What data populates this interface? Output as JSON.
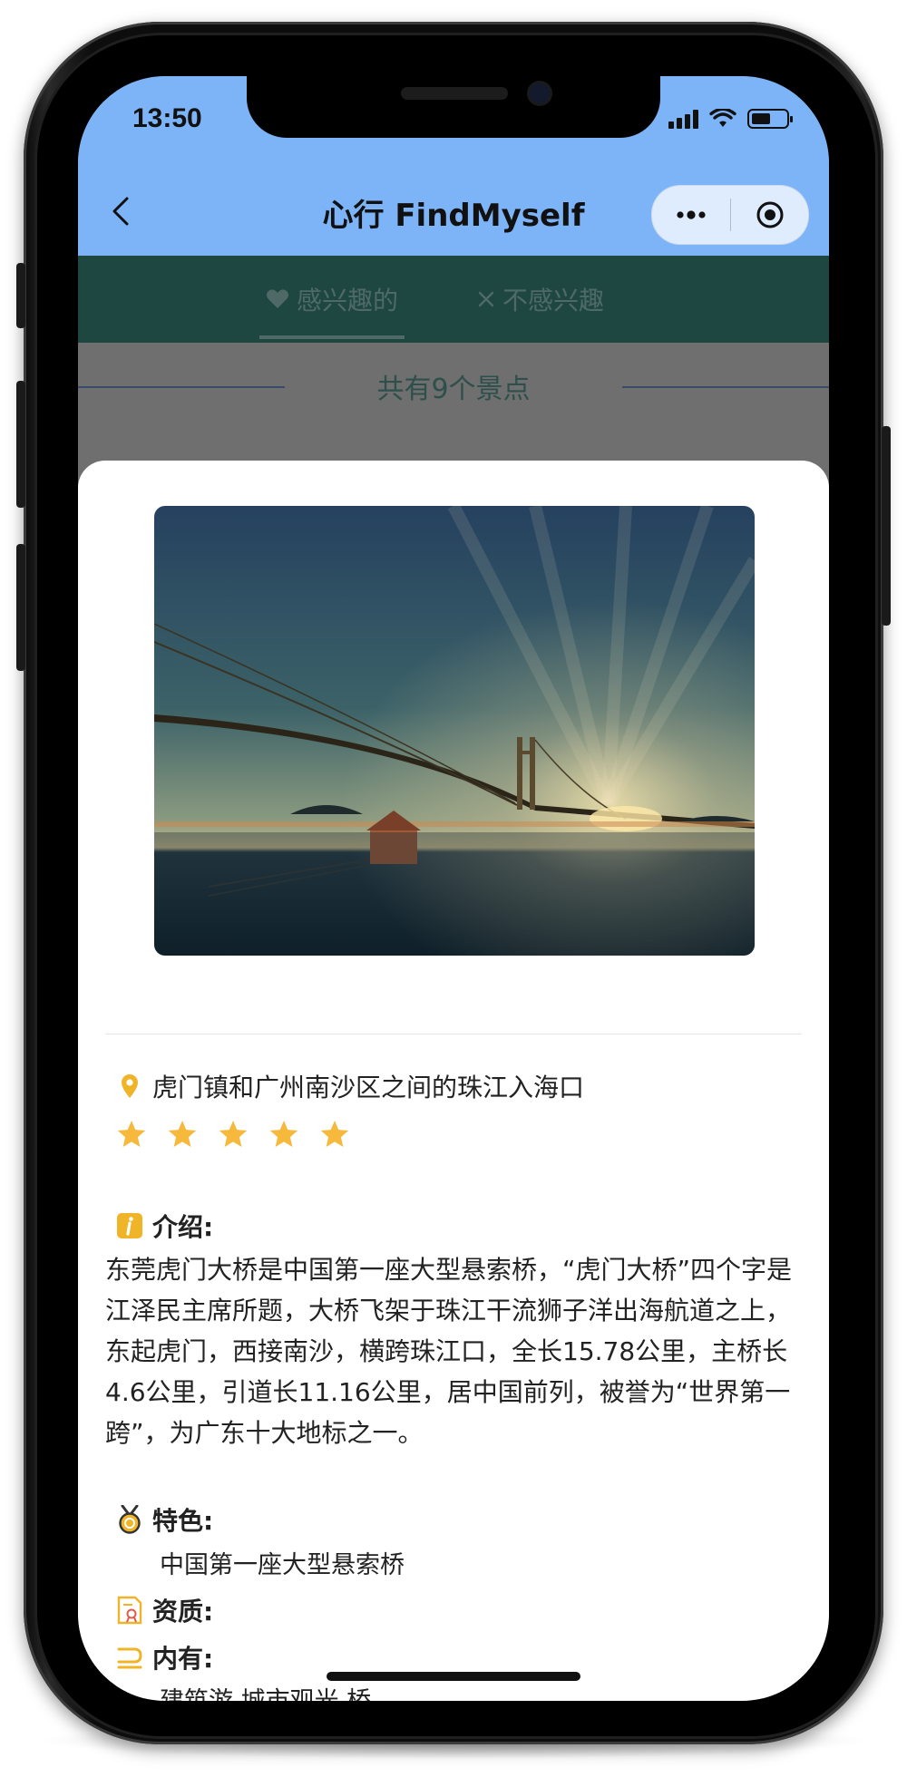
{
  "status_bar": {
    "time": "13:50"
  },
  "nav": {
    "title": "心行 FindMyself"
  },
  "tabs": [
    {
      "label": "感兴趣的",
      "icon": "heart-icon"
    },
    {
      "label": "不感兴趣",
      "icon": "close-icon"
    }
  ],
  "summary": {
    "text": "共有9个景点"
  },
  "detail": {
    "image_alt": "humen-bridge-night-photo",
    "location": "虎门镇和广州南沙区之间的珠江入海口",
    "rating": 5,
    "intro": {
      "title": "介绍:",
      "text": "东莞虎门大桥是中国第一座大型悬索桥，“虎门大桥”四个字是江泽民主席所题，大桥飞架于珠江干流狮子洋出海航道之上，东起虎门，西接南沙，横跨珠江口，全长15.78公里，主桥长4.6公里，引道长11.16公里，居中国前列，被誉为“世界第一跨”，为广东十大地标之一。"
    },
    "feature": {
      "title": "特色:",
      "value": "中国第一座大型悬索桥"
    },
    "qualification": {
      "title": "资质:"
    },
    "contains": {
      "title": "内有:",
      "value": "建筑游,城市观光,桥"
    }
  },
  "colors": {
    "nav_bg": "#7db4f7",
    "tab_bg_dimmed": "#1f4742",
    "overlay": "#6f6f6f",
    "star": "#f6b93b",
    "accent_icon": "#f0b429"
  }
}
